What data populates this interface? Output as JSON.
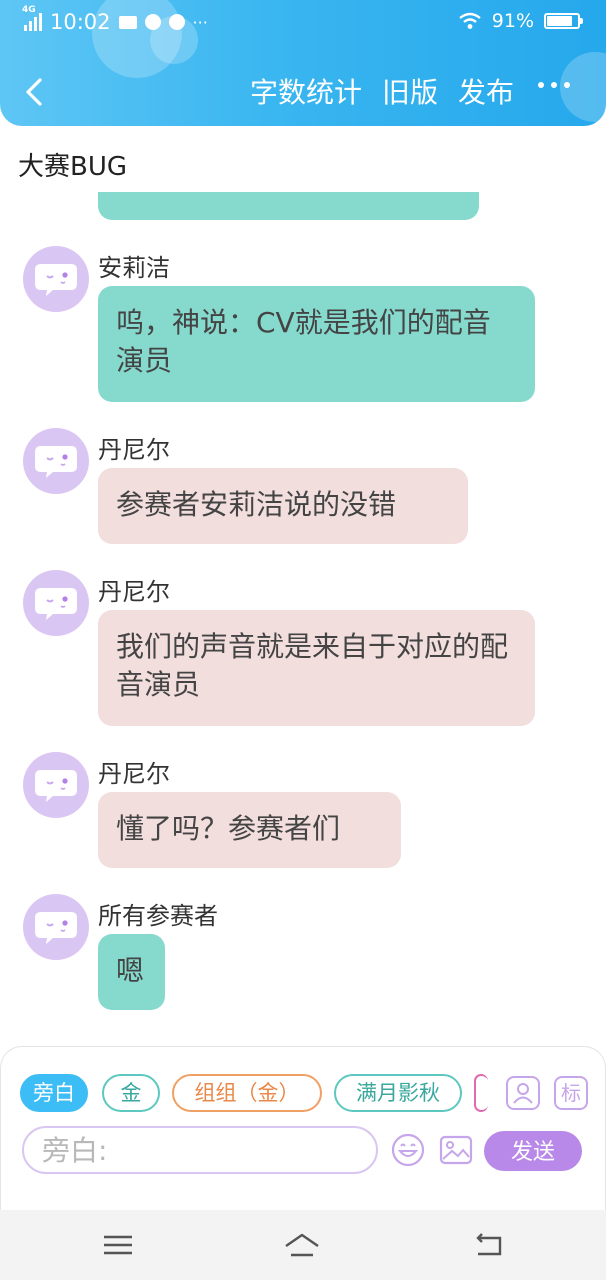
{
  "status_bar": {
    "network": "4G",
    "time": "10:02",
    "dots": "···",
    "battery": "91%",
    "battery_level": 0.91
  },
  "header": {
    "actions": [
      "字数统计",
      "旧版",
      "发布"
    ]
  },
  "chat": {
    "title": "大赛BUG",
    "messages": [
      {
        "sender": "安莉洁",
        "text": "呜，神说：CV就是我们的配音演员",
        "style": "teal"
      },
      {
        "sender": "丹尼尔",
        "text": "参赛者安莉洁说的没错",
        "style": "pink"
      },
      {
        "sender": "丹尼尔",
        "text": "我们的声音就是来自于对应的配音演员",
        "style": "pink"
      },
      {
        "sender": "丹尼尔",
        "text": "懂了吗？参赛者们",
        "style": "pink"
      },
      {
        "sender": "所有参赛者",
        "text": "嗯",
        "style": "teal"
      }
    ]
  },
  "composer": {
    "chips": [
      "旁白",
      "金",
      "组组（金）",
      "满月影秋"
    ],
    "tag_icon_label": "标",
    "input_placeholder": "旁白:",
    "send_label": "发送"
  },
  "colors": {
    "header_blue": "#3ab6f0",
    "teal_bubble": "#86d9cd",
    "pink_bubble": "#f1dedd",
    "avatar_purple": "#d9c6f3",
    "send_purple": "#b889e8"
  }
}
